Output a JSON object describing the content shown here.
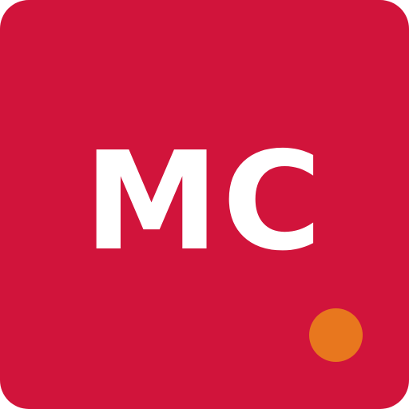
{
  "icon": {
    "monogram": "MC",
    "background_color": "#d1143b",
    "text_color": "#ffffff",
    "dot_color": "#e8771e",
    "dot_icon": "notification-dot-icon"
  }
}
